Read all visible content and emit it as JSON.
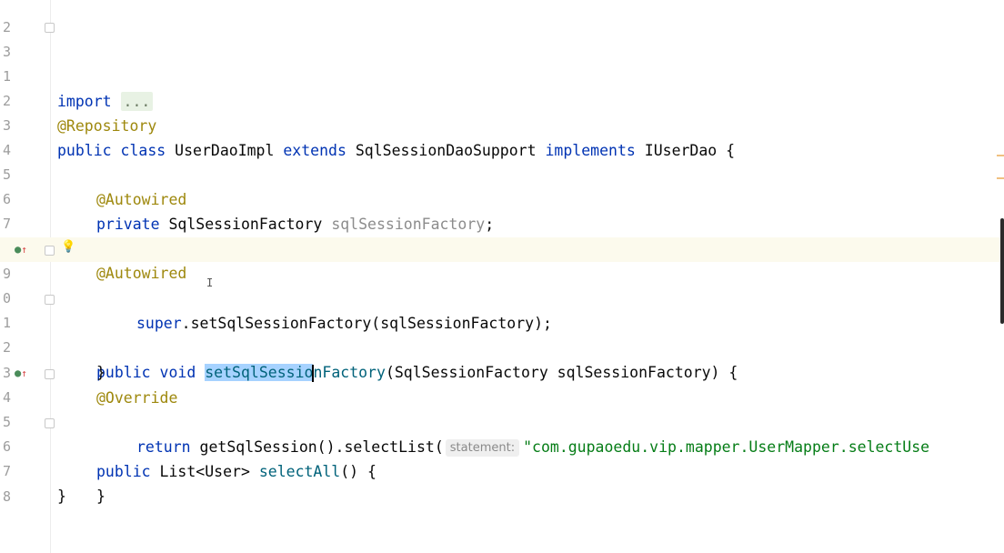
{
  "editor": {
    "line_numbers": [
      "2",
      "3",
      "1",
      "2",
      "3",
      "4",
      "5",
      "6",
      "7",
      "8",
      "9",
      "0",
      "1",
      "2",
      "3",
      "4",
      "5",
      "6",
      "7",
      "8"
    ],
    "lines": {
      "l3_import": "import",
      "l3_fold": "...",
      "l2_annotation": "@Repository",
      "l3_public": "public",
      "l3_class": "class",
      "l3_name": "UserDaoImpl",
      "l3_extends": "extends",
      "l3_super": "SqlSessionDaoSupport",
      "l3_implements": "implements",
      "l3_iface": "IUserDao {",
      "l5_annotation": "@Autowired",
      "l6_private": "private",
      "l6_type": "SqlSessionFactory",
      "l6_field": "sqlSessionFactory",
      "l6_semi": ";",
      "l8_annotation": "@Autowired",
      "l9_public": "public",
      "l9_void": "void",
      "l9_sel": "setSqlSessio",
      "l9_rest": "nFactory",
      "l9_params": "(SqlSessionFactory sqlSessionFactory) {",
      "l10_super": "super",
      "l10_call": ".setSqlSessionFactory(sqlSessionFactory);",
      "l11_brace": "}",
      "l13_annotation": "@Override",
      "l14_public": "public",
      "l14_sig": "List<User>",
      "l14_method": "selectAll",
      "l14_rest": "() {",
      "l15_return": "return",
      "l15_call": "getSqlSession().selectList(",
      "l15_hint": "statement:",
      "l15_str": "\"com.gupaoedu.vip.mapper.UserMapper.selectUse",
      "l16_brace": "}",
      "l17_brace": "}"
    }
  },
  "colors": {
    "keyword": "#0033b3",
    "annotation": "#9e880d",
    "string": "#067d17",
    "selection": "#a6d2ff",
    "current_line": "#fcfaed"
  },
  "icons": [
    "implement-marker-icon",
    "lightbulb-icon",
    "fold-icon"
  ]
}
